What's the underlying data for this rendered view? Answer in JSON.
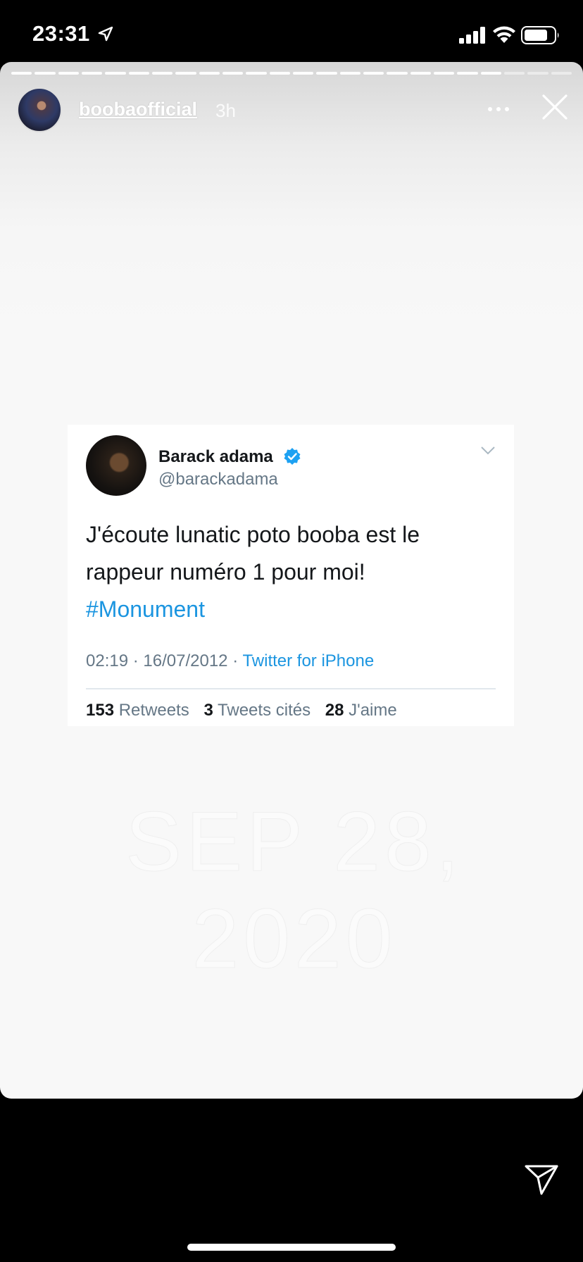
{
  "status_bar": {
    "time": "23:31",
    "icons": [
      "location-arrow-icon",
      "cellular-signal-icon",
      "wifi-icon",
      "battery-icon"
    ]
  },
  "story": {
    "username": "boobaofficial",
    "time_ago": "3h",
    "progress_segments_total": 24,
    "progress_segments_viewed": 21,
    "more_icon": "ellipsis-icon",
    "close_icon": "close-icon",
    "date_sticker": "SEP 28, 2020"
  },
  "tweet": {
    "display_name": "Barack adama",
    "handle": "@barackadama",
    "verified": true,
    "text": "J'écoute lunatic poto booba est le rappeur numéro 1 pour moi!",
    "hashtag": "#Monument",
    "time": "02:19",
    "date": "16/07/2012",
    "source": "Twitter for iPhone",
    "retweets_count": "153",
    "retweets_label": "Retweets",
    "quotes_count": "3",
    "quotes_label": "Tweets cités",
    "likes_count": "28",
    "likes_label": "J'aime"
  },
  "footer": {
    "send_icon": "paper-plane-icon"
  },
  "colors": {
    "twitter_blue": "#1b95e0",
    "verified_blue": "#1da1f2",
    "text_dark": "#14171a",
    "text_gray": "#657786"
  }
}
